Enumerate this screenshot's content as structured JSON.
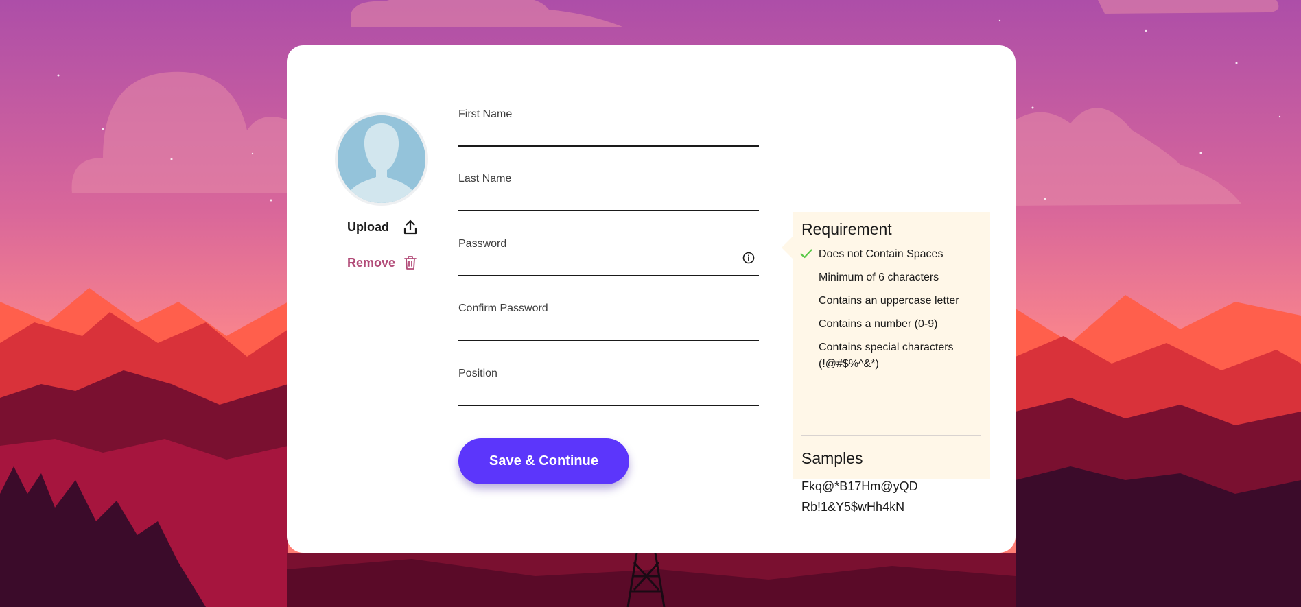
{
  "profile": {
    "upload_label": "Upload",
    "remove_label": "Remove"
  },
  "form": {
    "first_name": {
      "label": "First Name",
      "value": ""
    },
    "last_name": {
      "label": "Last Name",
      "value": ""
    },
    "password": {
      "label": "Password",
      "value": ""
    },
    "confirm_password": {
      "label": "Confirm Password",
      "value": ""
    },
    "position": {
      "label": "Position",
      "value": ""
    },
    "save_label": "Save & Continue"
  },
  "requirements": {
    "title": "Requirement",
    "items": [
      {
        "text": "Does not Contain Spaces",
        "met": true
      },
      {
        "text": "Minimum of 6 characters",
        "met": false
      },
      {
        "text": "Contains an uppercase letter",
        "met": false
      },
      {
        "text": "Contains a number (0-9)",
        "met": false
      },
      {
        "text": "Contains special characters (!@#$%^&*)",
        "met": false
      }
    ],
    "samples_title": "Samples",
    "samples": [
      "Fkq@*B17Hm@yQD",
      "Rb!1&Y5$wHh4kN"
    ]
  },
  "icons": {
    "avatar": "user-silhouette-icon",
    "upload": "upload-icon",
    "remove": "trash-icon",
    "info": "info-icon",
    "check": "check-icon"
  },
  "colors": {
    "primary_button": "#5c36fb",
    "remove_text": "#b24b78",
    "requirement_bg": "#fff7e8",
    "check": "#5cc94a"
  }
}
